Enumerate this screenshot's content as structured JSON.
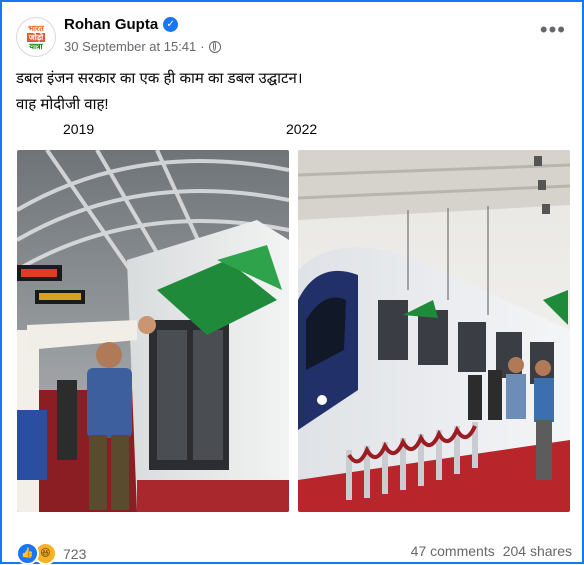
{
  "post": {
    "author": "Rohan Gupta",
    "timestamp": "30 September at 15:41",
    "separator": "·",
    "audience_icon": "globe-icon",
    "avatar_text": [
      "भारत",
      "जोड़ो",
      "यात्रा"
    ],
    "text_line1": "डबल इंजन सरकार का एक ही काम का डबल उद्घाटन।",
    "text_line2": "वाह मोदीजी वाह!",
    "more_icon": "•••",
    "verified_icon": "✓"
  },
  "images": [
    {
      "year": "2019",
      "icon": "metro-inauguration-photo"
    },
    {
      "year": "2022",
      "icon": "vande-bharat-inauguration-photo"
    }
  ],
  "footer": {
    "reaction_count": "723",
    "comments": "47 comments",
    "shares": "204 shares",
    "like_glyph": "👍",
    "haha_glyph": "😆"
  },
  "colors": {
    "accent": "#1877f2",
    "text": "#050505",
    "muted": "#65676b",
    "carpet": "#b8262b",
    "flag": "#1f8a3a"
  }
}
